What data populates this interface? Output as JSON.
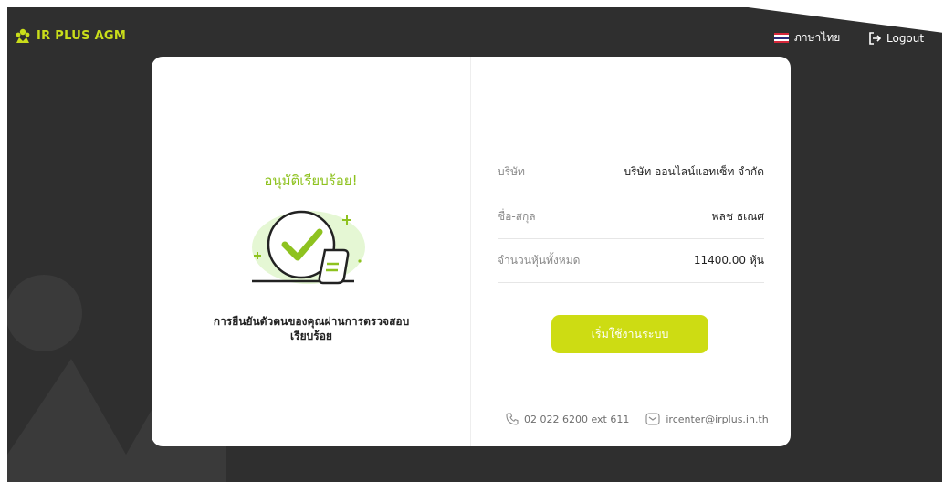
{
  "header": {
    "brand": "IR PLUS AGM",
    "language": "ภาษาไทย",
    "logout": "Logout"
  },
  "success": {
    "title": "อนุมัติเรียบร้อย!",
    "message_line1": "การยืนยันตัวตนของคุณผ่านการตรวจสอบ",
    "message_line2": "เรียบร้อย"
  },
  "info": [
    {
      "label": "บริษัท",
      "value": "บริษัท ออนไลน์แอทเซ็ท จำกัด"
    },
    {
      "label": "ชื่อ-สกุล",
      "value": "พลช ธเณศ"
    },
    {
      "label": "จำนวนหุ้นทั้งหมด",
      "value": "11400.00 หุ้น"
    }
  ],
  "start_button": "เริ่มใช้งานระบบ",
  "contact": {
    "phone": "02 022 6200 ext 611",
    "email": "ircenter@irplus.in.th"
  },
  "icons": {
    "brand": "brand-logo-icon",
    "flag": "thai-flag-icon",
    "logout": "logout-icon",
    "phone": "phone-icon",
    "email": "email-icon",
    "success": "check-document-icon"
  },
  "colors": {
    "background": "#2f2f2f",
    "brand": "#c9dd1a",
    "title_green": "#8ec21f",
    "button": "#cddc13",
    "card": "#ffffff"
  }
}
